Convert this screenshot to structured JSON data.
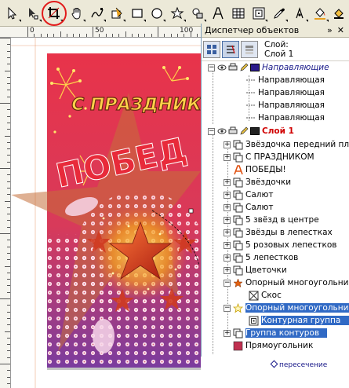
{
  "toolbar": {
    "tools": [
      "pick-tool",
      "shape-tool",
      "crop-tool",
      "pan-tool",
      "freehand-tool",
      "smart-fill-tool",
      "rectangle-tool",
      "ellipse-tool",
      "star-tool",
      "basic-shapes-tool",
      "text-tool",
      "table-tool",
      "blend-tool",
      "eyedropper-tool",
      "outline-tool",
      "fill-tool",
      "interactive-fill-tool"
    ],
    "highlighted_tool": "crop-tool"
  },
  "ruler": {
    "labels": [
      "0",
      "50",
      "100"
    ]
  },
  "canvas": {
    "title_text": "С ПРАЗДНИК",
    "victory_text": "ПОБЕД",
    "colors": {
      "bg_top": "#e03545",
      "bg_bottom": "#7a3aa0",
      "star": "#e85020",
      "gold": "#f5b030"
    }
  },
  "docker": {
    "title": "Диспетчер объектов",
    "current_layer_label": "Слой:",
    "current_layer_name": "Слой 1",
    "rows": [
      {
        "label": "Направляющие",
        "kind": "layer-guides"
      },
      {
        "label": "Направляющая",
        "kind": "guide"
      },
      {
        "label": "Направляющая",
        "kind": "guide"
      },
      {
        "label": "Направляющая",
        "kind": "guide"
      },
      {
        "label": "Направляющая",
        "kind": "guide"
      },
      {
        "label": "Слой 1",
        "kind": "layer"
      },
      {
        "label": "Звёздочка передний пл",
        "kind": "group"
      },
      {
        "label": "С ПРАЗДНИКОМ",
        "kind": "group"
      },
      {
        "label": "ПОБЕДЫ!",
        "kind": "text"
      },
      {
        "label": "Звёздочки",
        "kind": "group"
      },
      {
        "label": "Салют",
        "kind": "group"
      },
      {
        "label": "Салют",
        "kind": "group"
      },
      {
        "label": "5 звёзд в центре",
        "kind": "group"
      },
      {
        "label": "Звёзды в лепестках",
        "kind": "group"
      },
      {
        "label": "5 розовых лепестков",
        "kind": "group"
      },
      {
        "label": "5 лепестков",
        "kind": "group"
      },
      {
        "label": "Цветочки",
        "kind": "group"
      },
      {
        "label": "Опорный многоугольник",
        "kind": "polygon"
      },
      {
        "label": "Скос",
        "kind": "bevel"
      },
      {
        "label": "Опорный многоугольник",
        "kind": "polygon-selected"
      },
      {
        "label": "Контурная группа",
        "kind": "contour-group"
      },
      {
        "label": "Группа контуров",
        "kind": "group-selected"
      },
      {
        "label": "Прямоугольник",
        "kind": "rect"
      }
    ]
  },
  "status": {
    "label": "пересечение"
  }
}
